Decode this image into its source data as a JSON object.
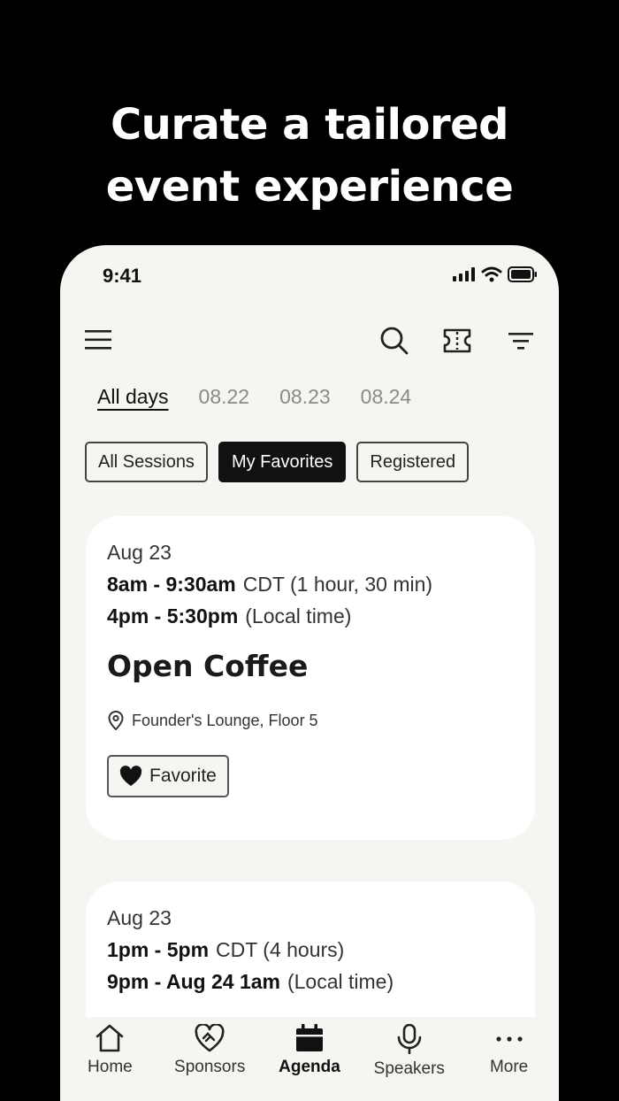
{
  "headline": {
    "line1": "Curate a tailored",
    "line2": "event experience"
  },
  "status_bar": {
    "time": "9:41"
  },
  "toolbar": {
    "icons": [
      "menu-icon",
      "search-icon",
      "ticket-icon",
      "filter-icon"
    ]
  },
  "day_tabs": [
    "All days",
    "08.22",
    "08.23",
    "08.24"
  ],
  "filters": {
    "all": "All Sessions",
    "favorites": "My Favorites",
    "registered": "Registered",
    "selected": "My Favorites"
  },
  "sessions": [
    {
      "date": "Aug 23",
      "time_cdt": "8am - 9:30am",
      "tz_cdt": "CDT",
      "duration": "(1 hour, 30 min)",
      "time_local": "4pm - 5:30pm",
      "local_label": "(Local time)",
      "title": "Open Coffee",
      "location": "Founder's Lounge, Floor 5",
      "favorite_label": "Favorite"
    },
    {
      "date": "Aug 23",
      "time_cdt": "1pm - 5pm",
      "tz_cdt": "CDT",
      "duration": "(4 hours)",
      "time_local": "9pm - Aug 24  1am",
      "local_label": "(Local time)"
    }
  ],
  "tabbar": {
    "items": [
      {
        "label": "Home",
        "icon": "home-icon"
      },
      {
        "label": "Sponsors",
        "icon": "handshake-heart-icon"
      },
      {
        "label": "Agenda",
        "icon": "calendar-icon"
      },
      {
        "label": "Speakers",
        "icon": "microphone-icon"
      },
      {
        "label": "More",
        "icon": "more-dots-icon"
      }
    ],
    "active": "Agenda"
  },
  "colors": {
    "background": "#000000",
    "screen": "#f6f5f1",
    "card": "#ffffff",
    "accent": "#111111"
  }
}
